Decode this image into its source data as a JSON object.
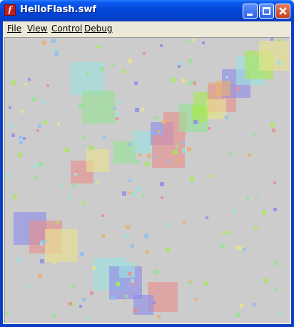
{
  "window": {
    "title": "HelloFlash.swf",
    "icon": "flash-player-icon"
  },
  "menu": [
    {
      "label": "File"
    },
    {
      "label": "View"
    },
    {
      "label": "Control"
    },
    {
      "label": "Debug"
    }
  ],
  "colors": {
    "stage_bg": "#cccccc",
    "palette": [
      "#9ee0e0",
      "#98e098",
      "#8f8fe8",
      "#e89090",
      "#e8e090",
      "#a8e858",
      "#e8b070",
      "#90c0f0"
    ]
  },
  "stage": {
    "content": "randomly placed semi-transparent colored squares (Flash animation)"
  }
}
